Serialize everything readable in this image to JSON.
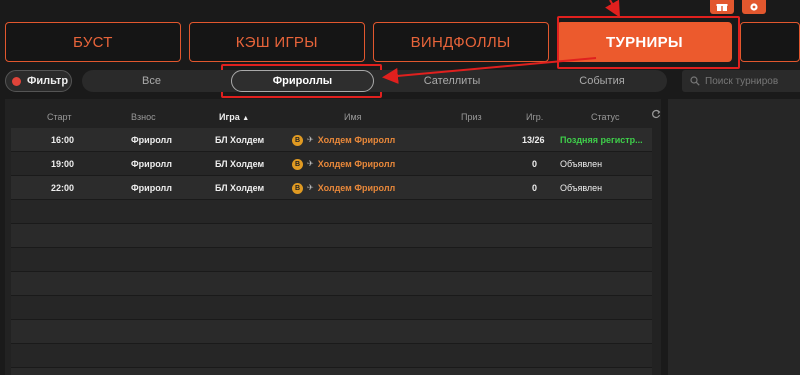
{
  "top_icons": [
    {
      "icon": "gift-icon"
    },
    {
      "icon": "settings-icon"
    }
  ],
  "main_tabs": [
    {
      "label": "БУСТ",
      "active": false
    },
    {
      "label": "КЭШ ИГРЫ",
      "active": false
    },
    {
      "label": "ВИНДФОЛЛЫ",
      "active": false
    },
    {
      "label": "ТУРНИРЫ",
      "active": true
    },
    {
      "label": "",
      "active": false
    }
  ],
  "filter": {
    "label": "Фильтр"
  },
  "sub_tabs": [
    {
      "label": "Все",
      "active": false
    },
    {
      "label": "Фрироллы",
      "active": true
    },
    {
      "label": "Сателлиты",
      "active": false
    },
    {
      "label": "События",
      "active": false
    }
  ],
  "search": {
    "placeholder": "Поиск турниров"
  },
  "table": {
    "headers": {
      "start": "Старт",
      "buyin": "Взнос",
      "game": "Игра",
      "game_sort": "▲",
      "name": "Имя",
      "prize": "Приз",
      "players": "Игр.",
      "status": "Статус"
    },
    "rows": [
      {
        "start": "16:00",
        "buyin": "Фриролл",
        "game": "БЛ Холдем",
        "badge": "B",
        "name": "Холдем Фриролл",
        "prize": "",
        "players": "13/26",
        "status": "Поздняя регистр...",
        "status_kind": "late"
      },
      {
        "start": "19:00",
        "buyin": "Фриролл",
        "game": "БЛ Холдем",
        "badge": "B",
        "name": "Холдем Фриролл",
        "prize": "",
        "players": "0",
        "status": "Объявлен",
        "status_kind": "announced"
      },
      {
        "start": "22:00",
        "buyin": "Фриролл",
        "game": "БЛ Холдем",
        "badge": "B",
        "name": "Холдем Фриролл",
        "prize": "",
        "players": "0",
        "status": "Объявлен",
        "status_kind": "announced"
      }
    ],
    "empty_rows": 7
  },
  "colors": {
    "accent": "#ec5a2d",
    "highlight_box": "#e0201e",
    "late_status": "#3ecf4a",
    "tournament_name": "#e8883a"
  }
}
